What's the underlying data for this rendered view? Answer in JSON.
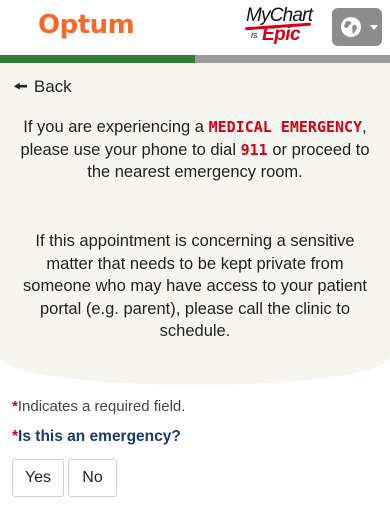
{
  "header": {
    "brand": "Optum",
    "mychart_name": "MyChart",
    "mychart_is": "is",
    "mychart_epic": "Epic",
    "language_icon": "globe-icon"
  },
  "progress": {
    "percent": 50,
    "fill_color": "#2e7d32",
    "track_color": "#9a9a9a"
  },
  "main": {
    "back_label": "Back",
    "msg1": {
      "part1": "If you are experiencing a",
      "emergency": "MEDICAL EMERGENCY",
      "part2": ", please use your phone to dial",
      "number": "911",
      "part3": "or proceed to the nearest emergency room."
    },
    "msg2": "If this appointment is concerning a sensitive matter that needs to be kept private from someone who may have access to your patient portal (e.g. parent), please call the clinic to schedule."
  },
  "form": {
    "required_star": "*",
    "required_note": "Indicates a required field.",
    "question": "Is this an emergency?",
    "options": [
      "Yes",
      "No"
    ]
  },
  "colors": {
    "brand": "#f26b2b",
    "alert": "#d0021b",
    "question": "#1b3a6b"
  }
}
